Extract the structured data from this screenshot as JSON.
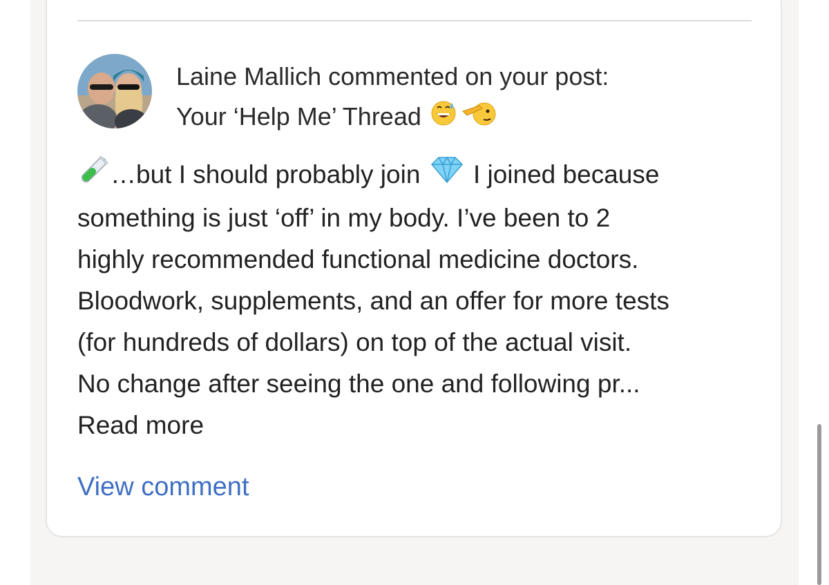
{
  "notification": {
    "author": "Laine Mallich",
    "action_text": "commented on your post:",
    "post_title": "Your ‘Help Me’ Thread",
    "post_title_emojis": [
      "grinning-sweat-emoji",
      "saluting-face-emoji"
    ],
    "comment_lines": [
      "…but I should probably join",
      "I joined because",
      "something is just ‘off’ in my body. I’ve been to 2",
      "highly recommended functional medicine doctors.",
      "Bloodwork, supplements, and an offer for more tests",
      "(for hundreds of dollars) on top of the actual visit.",
      "No change after seeing the one and following pr..."
    ],
    "comment_emojis": [
      "test-tube-emoji",
      "gem-emoji"
    ],
    "read_more_label": "Read more",
    "view_comment_label": "View comment"
  },
  "colors": {
    "link": "#3f6fc4",
    "text": "#222222",
    "background": "#f6f5f4",
    "card": "#ffffff"
  }
}
